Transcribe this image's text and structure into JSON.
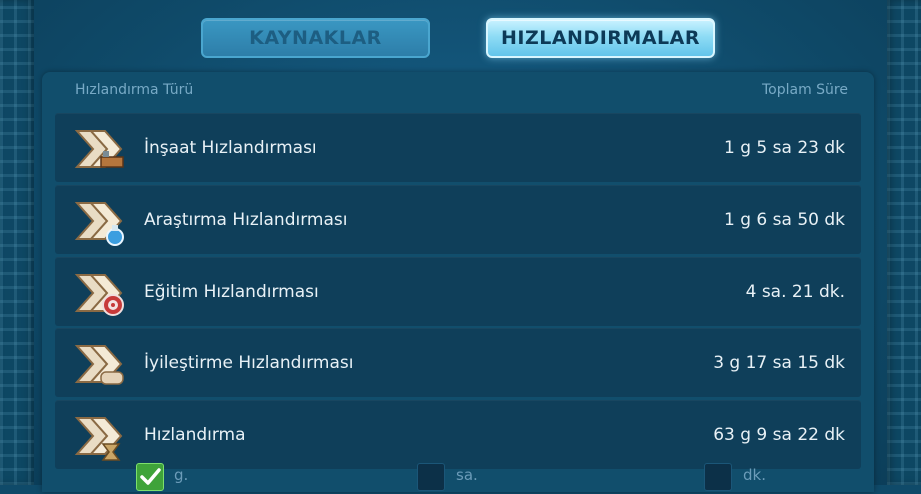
{
  "tabs": {
    "resources": "KAYNAKLAR",
    "speedups": "HIZLANDIRMALAR",
    "active": "speedups"
  },
  "header": {
    "type_label": "Hızlandırma Türü",
    "total_label": "Toplam Süre"
  },
  "rows": [
    {
      "icon": "construction-speedup-icon",
      "label": "İnşaat Hızlandırması",
      "value": "1 g 5 sa 23 dk"
    },
    {
      "icon": "research-speedup-icon",
      "label": "Araştırma Hızlandırması",
      "value": "1 g 6 sa 50 dk"
    },
    {
      "icon": "training-speedup-icon",
      "label": "Eğitim Hızlandırması",
      "value": "4 sa. 21 dk."
    },
    {
      "icon": "healing-speedup-icon",
      "label": "İyileştirme Hızlandırması",
      "value": "3 g 17 sa 15 dk"
    },
    {
      "icon": "universal-speedup-icon",
      "label": "Hızlandırma",
      "value": "63 g 9 sa 22 dk"
    }
  ],
  "format_options": [
    {
      "label": "g.",
      "checked": true
    },
    {
      "label": "sa.",
      "checked": false
    },
    {
      "label": "dk.",
      "checked": false
    }
  ],
  "colors": {
    "background": "#0f4a69",
    "row": "#0f3f5a",
    "active_tab": "#8fdcf5",
    "inactive_tab": "#2d7ea9",
    "check_green": "#3fa33a"
  }
}
